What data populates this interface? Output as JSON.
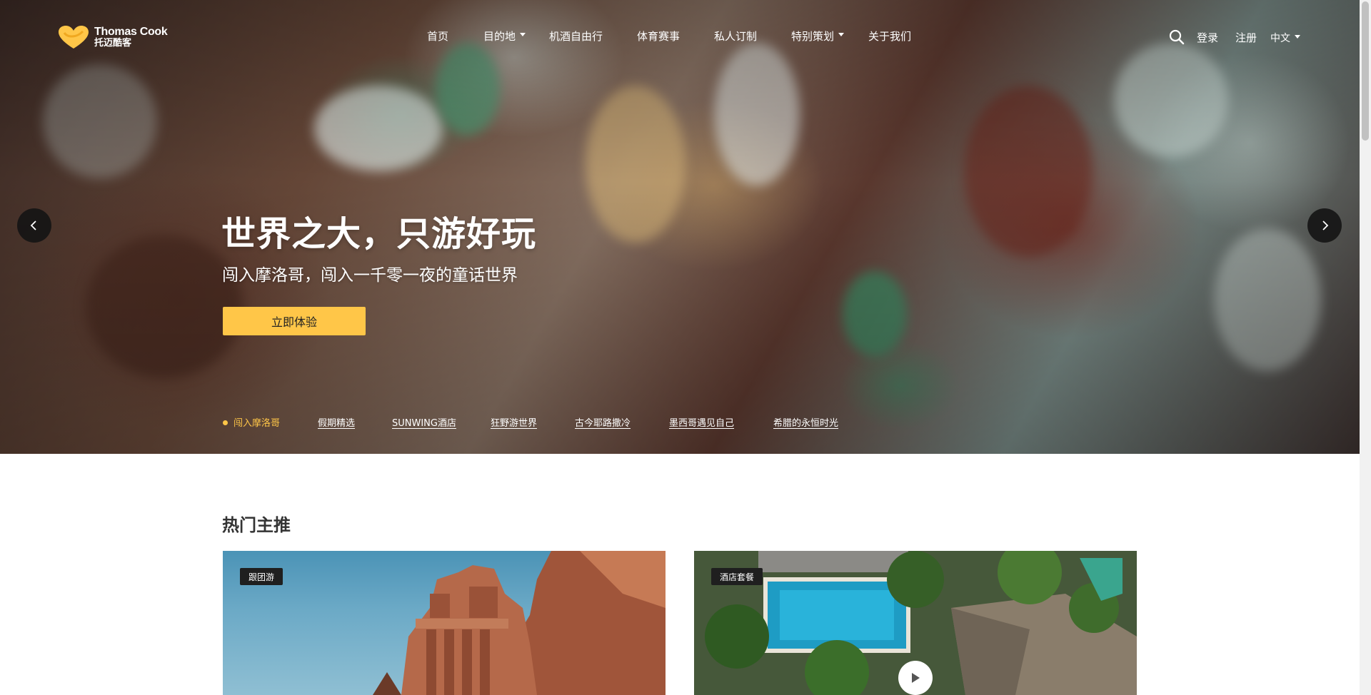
{
  "brand": {
    "name_en": "Thomas Cook",
    "name_cn": "托迈酷客",
    "logo_color": "#ffc648"
  },
  "nav": {
    "items": [
      {
        "label": "首页",
        "has_dropdown": false
      },
      {
        "label": "目的地",
        "has_dropdown": true
      },
      {
        "label": "机酒自由行",
        "has_dropdown": false
      },
      {
        "label": "体育赛事",
        "has_dropdown": false
      },
      {
        "label": "私人订制",
        "has_dropdown": false
      },
      {
        "label": "特别策划",
        "has_dropdown": true
      },
      {
        "label": "关于我们",
        "has_dropdown": false
      }
    ],
    "search_icon": "search-icon",
    "login": "登录",
    "register": "注册",
    "language": "中文"
  },
  "hero": {
    "title": "世界之大，只游好玩",
    "subtitle": "闯入摩洛哥，闯入一千零一夜的童话世界",
    "cta": "立即体验",
    "prev_icon": "chevron-left-icon",
    "next_icon": "chevron-right-icon",
    "slides": [
      {
        "label": "闯入摩洛哥",
        "active": true
      },
      {
        "label": "假期精选",
        "active": false
      },
      {
        "label": "SUNWING酒店",
        "active": false
      },
      {
        "label": "狂野游世界",
        "active": false
      },
      {
        "label": "古今耶路撒冷",
        "active": false
      },
      {
        "label": "墨西哥遇见自己",
        "active": false
      },
      {
        "label": "希腊的永恒时光",
        "active": false
      }
    ],
    "accent_color": "#ffc648"
  },
  "featured": {
    "title": "热门主推",
    "cards": [
      {
        "tag": "跟团游"
      },
      {
        "tag": "酒店套餐",
        "play_icon": "play-icon"
      }
    ]
  }
}
